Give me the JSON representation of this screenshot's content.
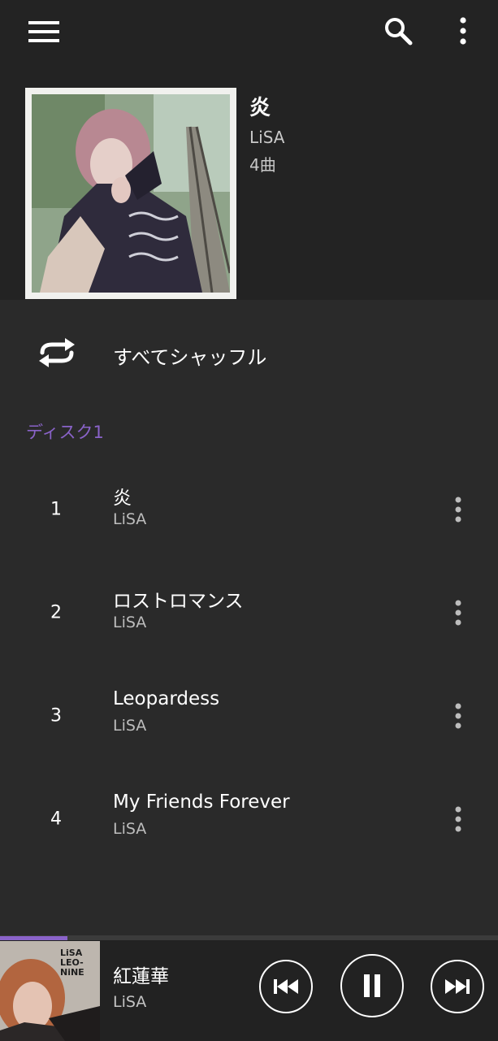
{
  "colors": {
    "background": "#2a2a2a",
    "header_background": "#232323",
    "accent": "#8a63c9",
    "secondary_text": "#bdbdbd"
  },
  "toolbar": {
    "menu_icon": "hamburger-menu-icon",
    "search_icon": "search-icon",
    "more_icon": "more-vertical-icon"
  },
  "album": {
    "title": "炎",
    "artist": "LiSA",
    "track_count": "4曲"
  },
  "shuffle": {
    "icon": "shuffle-repeat-icon",
    "label": "すべてシャッフル"
  },
  "disc": {
    "label": "ディスク1"
  },
  "tracks": [
    {
      "number": "1",
      "title": "炎",
      "artist": "LiSA"
    },
    {
      "number": "2",
      "title": "ロストロマンス",
      "artist": "LiSA"
    },
    {
      "number": "3",
      "title": "Leopardess",
      "artist": "LiSA"
    },
    {
      "number": "4",
      "title": "My Friends Forever",
      "artist": "LiSA"
    }
  ],
  "now_playing": {
    "title": "紅蓮華",
    "artist": "LiSA",
    "art_text_line1": "LiSA",
    "art_text_line2": "LEO-NiNE",
    "progress_fraction": 0.135,
    "prev_icon": "skip-previous-icon",
    "pause_icon": "pause-icon",
    "next_icon": "skip-next-icon"
  }
}
